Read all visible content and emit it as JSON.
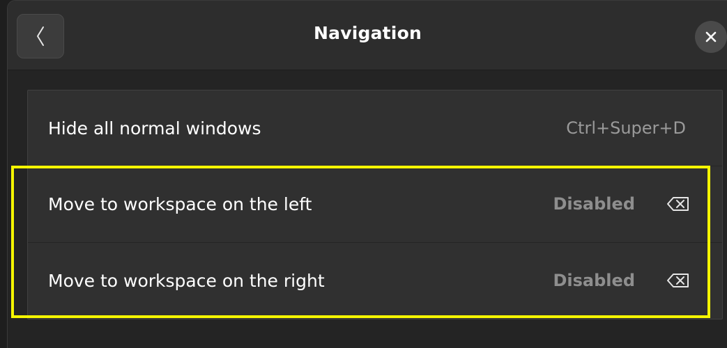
{
  "header": {
    "title": "Navigation",
    "back_icon": "chevron-left-icon",
    "close_icon": "close-icon"
  },
  "shortcuts": [
    {
      "label": "Hide all normal windows",
      "accelerator": "Ctrl+Super+D"
    },
    {
      "label": "Move to workspace on the left",
      "accelerator": "Disabled",
      "clear_icon": "backspace-icon"
    },
    {
      "label": "Move to workspace on the right",
      "accelerator": "Disabled",
      "clear_icon": "backspace-icon"
    }
  ],
  "colors": {
    "highlight": "#f5f500",
    "background": "#242424",
    "row": "#303030"
  }
}
